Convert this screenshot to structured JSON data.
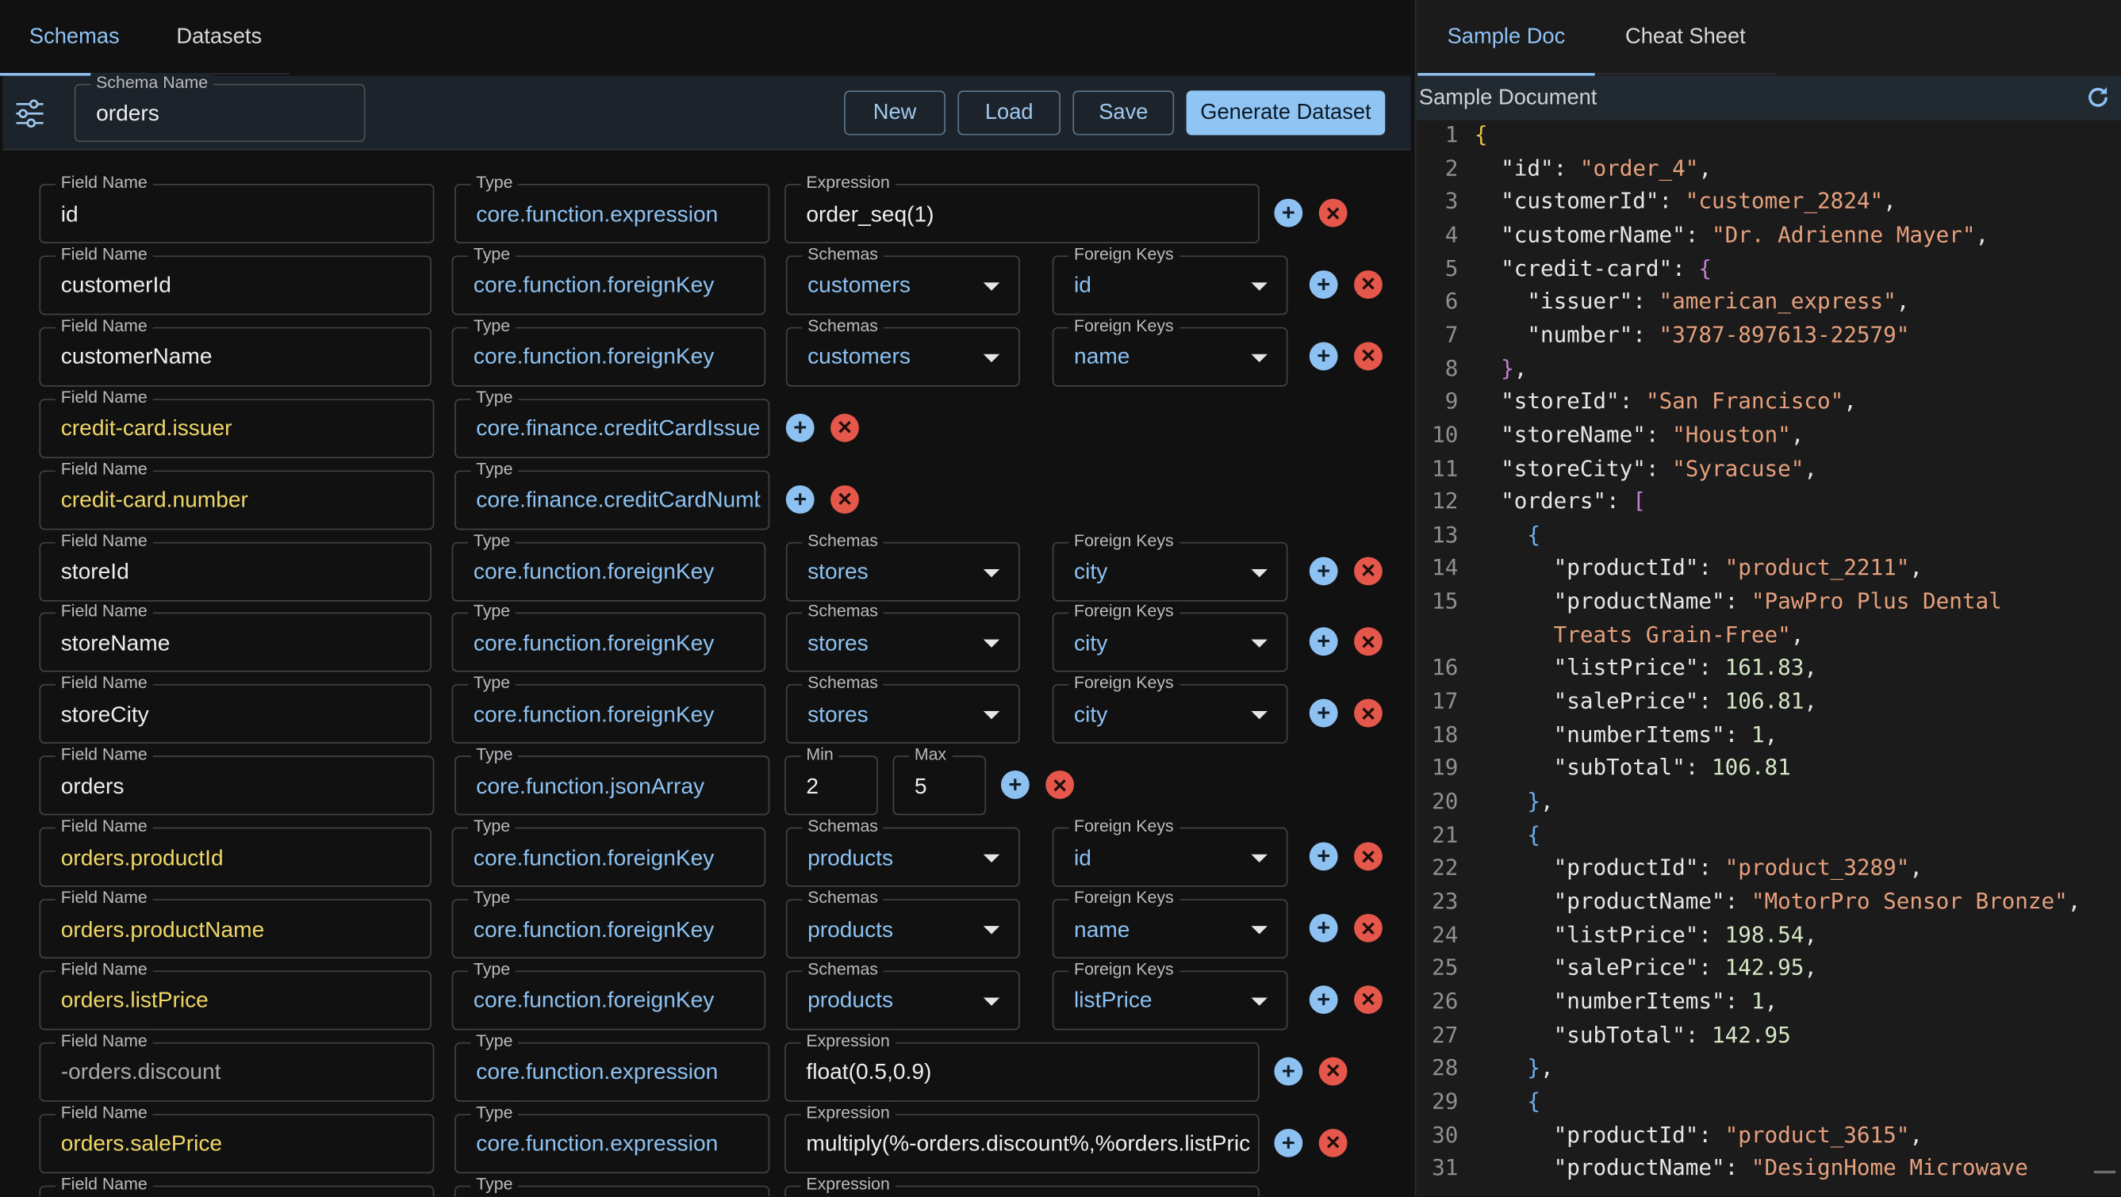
{
  "left_tabs": [
    "Schemas",
    "Datasets"
  ],
  "toolbar": {
    "schema_name_label": "Schema Name",
    "schema_name_value": "orders",
    "buttons": [
      "New",
      "Load",
      "Save",
      "Generate Dataset"
    ]
  },
  "field_rows": [
    {
      "name": "id",
      "type": "core.function.expression",
      "kind": "expression",
      "expression_label": "Expression",
      "expression": "order_seq(1)"
    },
    {
      "name": "customerId",
      "type": "core.function.foreignKey",
      "kind": "foreignKey",
      "schemas_label": "Schemas",
      "schema": "customers",
      "fk_label": "Foreign Keys",
      "fk": "id"
    },
    {
      "name": "customerName",
      "type": "core.function.foreignKey",
      "kind": "foreignKey",
      "schemas_label": "Schemas",
      "schema": "customers",
      "fk_label": "Foreign Keys",
      "fk": "name"
    },
    {
      "name": "credit-card.issuer",
      "type": "core.finance.creditCardIssuer",
      "kind": "simple",
      "nested": true
    },
    {
      "name": "credit-card.number",
      "type": "core.finance.creditCardNumber",
      "kind": "simple",
      "nested": true
    },
    {
      "name": "storeId",
      "type": "core.function.foreignKey",
      "kind": "foreignKey",
      "schemas_label": "Schemas",
      "schema": "stores",
      "fk_label": "Foreign Keys",
      "fk": "city"
    },
    {
      "name": "storeName",
      "type": "core.function.foreignKey",
      "kind": "foreignKey",
      "schemas_label": "Schemas",
      "schema": "stores",
      "fk_label": "Foreign Keys",
      "fk": "city"
    },
    {
      "name": "storeCity",
      "type": "core.function.foreignKey",
      "kind": "foreignKey",
      "schemas_label": "Schemas",
      "schema": "stores",
      "fk_label": "Foreign Keys",
      "fk": "city"
    },
    {
      "name": "orders",
      "type": "core.function.jsonArray",
      "kind": "minmax",
      "min_label": "Min",
      "min": "2",
      "max_label": "Max",
      "max": "5"
    },
    {
      "name": "orders.productId",
      "type": "core.function.foreignKey",
      "kind": "foreignKey",
      "nested": true,
      "schemas_label": "Schemas",
      "schema": "products",
      "fk_label": "Foreign Keys",
      "fk": "id"
    },
    {
      "name": "orders.productName",
      "type": "core.function.foreignKey",
      "kind": "foreignKey",
      "nested": true,
      "schemas_label": "Schemas",
      "schema": "products",
      "fk_label": "Foreign Keys",
      "fk": "name"
    },
    {
      "name": "orders.listPrice",
      "type": "core.function.foreignKey",
      "kind": "foreignKey",
      "nested": true,
      "schemas_label": "Schemas",
      "schema": "products",
      "fk_label": "Foreign Keys",
      "fk": "listPrice"
    },
    {
      "name": "-orders.discount",
      "type": "core.function.expression",
      "kind": "expression",
      "muted": true,
      "expression_label": "Expression",
      "expression": "float(0.5,0.9)"
    },
    {
      "name": "orders.salePrice",
      "type": "core.function.expression",
      "kind": "expression",
      "nested": true,
      "expression_label": "Expression",
      "expression": "multiply(%-orders.discount%,%orders.listPrice%)"
    },
    {
      "name": "",
      "type": "",
      "kind": "expression",
      "expression_label": "Expression",
      "expression": ""
    }
  ],
  "labels": {
    "field_name": "Field Name",
    "type": "Type"
  },
  "right_tabs": [
    "Sample Doc",
    "Cheat Sheet"
  ],
  "sample_header": "Sample Document",
  "code_lines": [
    {
      "n": "1",
      "t": "{"
    },
    {
      "n": "2",
      "t": "  \"id\": \"order_4\","
    },
    {
      "n": "3",
      "t": "  \"customerId\": \"customer_2824\","
    },
    {
      "n": "4",
      "t": "  \"customerName\": \"Dr. Adrienne Mayer\","
    },
    {
      "n": "5",
      "t": "  \"credit-card\": {"
    },
    {
      "n": "6",
      "t": "    \"issuer\": \"american_express\","
    },
    {
      "n": "7",
      "t": "    \"number\": \"3787-897613-22579\""
    },
    {
      "n": "8",
      "t": "  },"
    },
    {
      "n": "9",
      "t": "  \"storeId\": \"San Francisco\","
    },
    {
      "n": "10",
      "t": "  \"storeName\": \"Houston\","
    },
    {
      "n": "11",
      "t": "  \"storeCity\": \"Syracuse\","
    },
    {
      "n": "12",
      "t": "  \"orders\": ["
    },
    {
      "n": "13",
      "t": "    {"
    },
    {
      "n": "14",
      "t": "      \"productId\": \"product_2211\","
    },
    {
      "n": "15",
      "t": "      \"productName\": \"PawPro Plus Dental"
    },
    {
      "n": "",
      "t": "      Treats Grain-Free\","
    },
    {
      "n": "16",
      "t": "      \"listPrice\": 161.83,"
    },
    {
      "n": "17",
      "t": "      \"salePrice\": 106.81,"
    },
    {
      "n": "18",
      "t": "      \"numberItems\": 1,"
    },
    {
      "n": "19",
      "t": "      \"subTotal\": 106.81"
    },
    {
      "n": "20",
      "t": "    },"
    },
    {
      "n": "21",
      "t": "    {"
    },
    {
      "n": "22",
      "t": "      \"productId\": \"product_3289\","
    },
    {
      "n": "23",
      "t": "      \"productName\": \"MotorPro Sensor Bronze\","
    },
    {
      "n": "24",
      "t": "      \"listPrice\": 198.54,"
    },
    {
      "n": "25",
      "t": "      \"salePrice\": 142.95,"
    },
    {
      "n": "26",
      "t": "      \"numberItems\": 1,"
    },
    {
      "n": "27",
      "t": "      \"subTotal\": 142.95"
    },
    {
      "n": "28",
      "t": "    },"
    },
    {
      "n": "29",
      "t": "    {"
    },
    {
      "n": "30",
      "t": "      \"productId\": \"product_3615\","
    },
    {
      "n": "31",
      "t": "      \"productName\": \"DesignHome Microwave"
    }
  ],
  "icons": {
    "filter": "tune-sliders-icon",
    "refresh": "refresh-icon",
    "add": "add-circle-icon",
    "delete": "delete-circle-icon"
  },
  "colors": {
    "accent": "#8fc3f5",
    "nested_field": "#efd766",
    "delete": "#e4574a",
    "background": "#111111"
  }
}
